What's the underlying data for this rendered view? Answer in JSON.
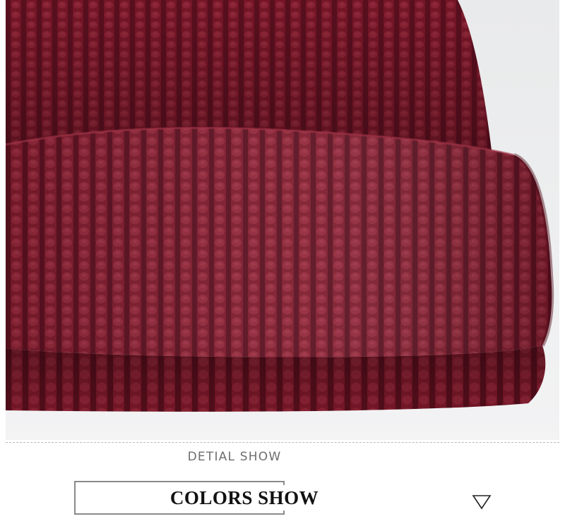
{
  "detail_caption": "DETIAL SHOW",
  "colors_heading": "COLORS SHOW",
  "product_photo": {
    "subject": "burgundy ribbed knit beanie",
    "knit_color": "#7d1a2c",
    "knit_shadow_color": "#5c0f1e",
    "knit_highlight_color": "#9a2b3e",
    "background_color": "#eceded"
  },
  "icons": {
    "arrow": "triangle-down-outline-icon"
  },
  "colors": {
    "divider": "#b9b9b9",
    "caption_text": "#6e6e6e",
    "box_border": "#8a8a8a",
    "heading_text": "#111111"
  }
}
